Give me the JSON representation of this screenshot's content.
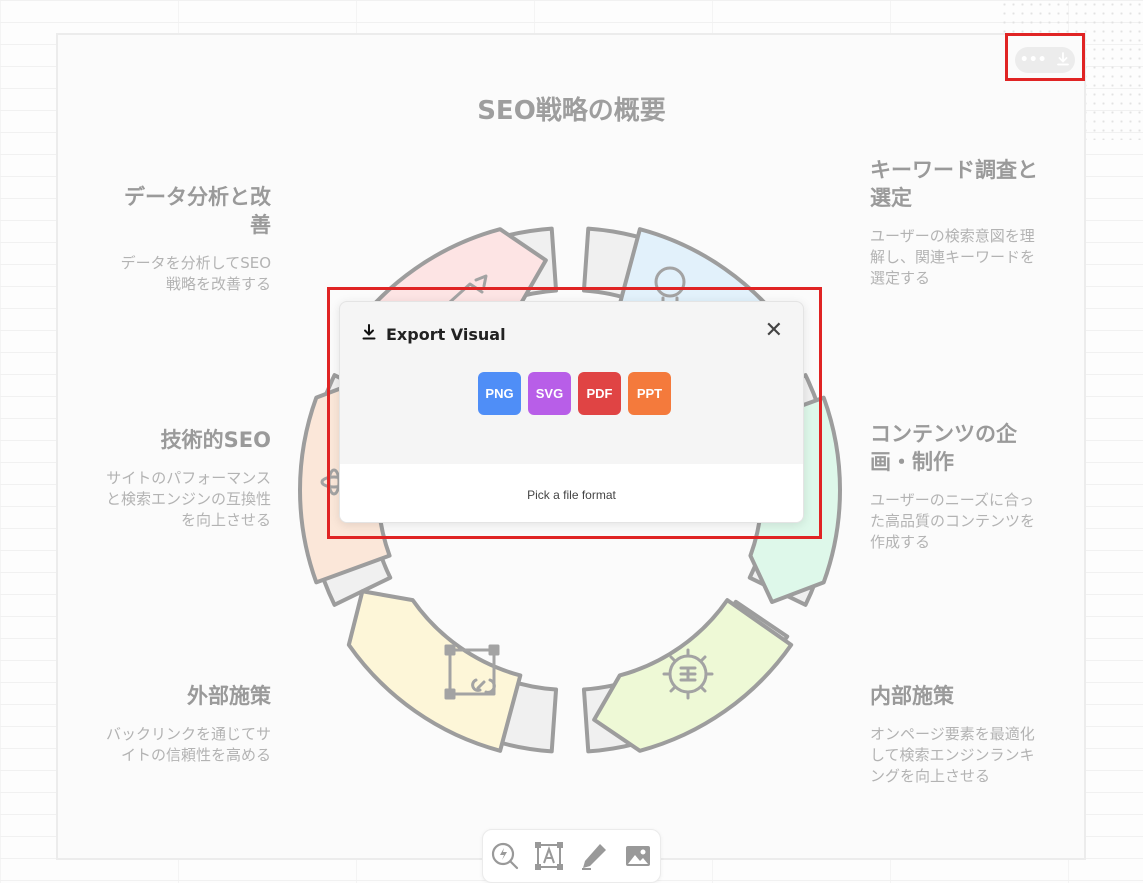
{
  "infographic": {
    "title": "SEO戦略の概要",
    "items": [
      {
        "heading": "データ分析と改善",
        "desc": "データを分析してSEO戦略を改善する"
      },
      {
        "heading": "キーワード調査と選定",
        "desc": "ユーザーの検索意図を理解し、関連キーワードを選定する"
      },
      {
        "heading": "技術的SEO",
        "desc": "サイトのパフォーマンスと検索エンジンの互換性を向上させる"
      },
      {
        "heading": "コンテンツの企画・制作",
        "desc": "ユーザーのニーズに合った高品質のコンテンツを作成する"
      },
      {
        "heading": "外部施策",
        "desc": "バックリンクを通じてサイトの信頼性を高める"
      },
      {
        "heading": "内部施策",
        "desc": "オンページ要素を最適化して検索エンジンランキングを向上させる"
      }
    ]
  },
  "top_toolbar": {
    "more_icon": "more-horizontal-icon",
    "download_icon": "download-icon"
  },
  "export_dialog": {
    "title": "Export Visual",
    "formats": [
      {
        "label": "PNG",
        "color": "#4f8ef7"
      },
      {
        "label": "SVG",
        "color": "#b85ee8"
      },
      {
        "label": "PDF",
        "color": "#e04444"
      },
      {
        "label": "PPT",
        "color": "#f47a3c"
      }
    ],
    "footer_text": "Pick a file format"
  },
  "bottom_toolbar": {
    "tools": [
      "spark-search-icon",
      "text-box-icon",
      "pen-icon",
      "image-icon"
    ]
  },
  "colors": {
    "highlight": "#e02424",
    "segments": [
      "#fde4e4",
      "#e2f1fb",
      "#fbe7d9",
      "#def8ea",
      "#fdf6d8",
      "#eef9d6"
    ]
  }
}
